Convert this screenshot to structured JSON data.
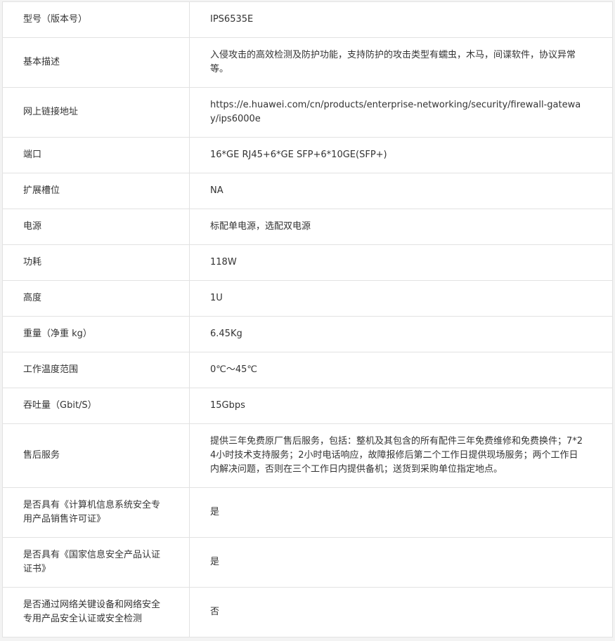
{
  "specs": [
    {
      "label": "型号（版本号）",
      "value": "IPS6535E"
    },
    {
      "label": "基本描述",
      "value": "入侵攻击的高效检测及防护功能，支持防护的攻击类型有蠕虫，木马，间谍软件，协议异常等。"
    },
    {
      "label": "网上链接地址",
      "value": "https://e.huawei.com/cn/products/enterprise-networking/security/firewall-gateway/ips6000e"
    },
    {
      "label": "端口",
      "value": "16*GE RJ45+6*GE SFP+6*10GE(SFP+)"
    },
    {
      "label": "扩展槽位",
      "value": "NA"
    },
    {
      "label": "电源",
      "value": "标配单电源，选配双电源"
    },
    {
      "label": "功耗",
      "value": "118W"
    },
    {
      "label": "高度",
      "value": "1U"
    },
    {
      "label": "重量（净重 kg）",
      "value": "6.45Kg"
    },
    {
      "label": "工作温度范围",
      "value": "0℃～45℃"
    },
    {
      "label": "吞吐量（Gbit/S）",
      "value": "15Gbps"
    },
    {
      "label": "售后服务",
      "value": "提供三年免费原厂售后服务，包括：整机及其包含的所有配件三年免费维修和免费换件；7*24小时技术支持服务；2小时电话响应，故障报修后第二个工作日提供现场服务；两个工作日内解决问题，否则在三个工作日内提供备机；送货到采购单位指定地点。"
    },
    {
      "label": "是否具有《计算机信息系统安全专用产品销售许可证》",
      "value": "是"
    },
    {
      "label": "是否具有《国家信息安全产品认证证书》",
      "value": "是"
    },
    {
      "label": "是否通过网络关键设备和网络安全专用产品安全认证或安全检测",
      "value": "否"
    }
  ]
}
